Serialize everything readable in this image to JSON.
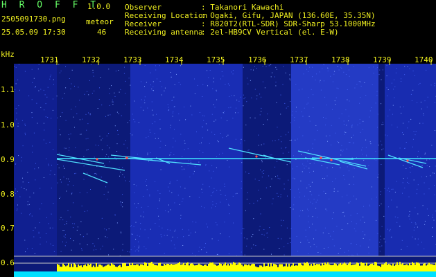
{
  "app": {
    "name": "H R O F F T",
    "version": "1.0.0",
    "filename": "2505091730.png",
    "datetime": "25.05.09 17:30",
    "count_label": "meteor",
    "count_value": "46"
  },
  "info": {
    "labels": [
      "Observer",
      "Receiving Location",
      "Receiver",
      "Receiving antenna"
    ],
    "values": [
      ": Takanori Kawachi",
      ": Ogaki, Gifu, JAPAN (136.60E, 35.35N)",
      ": R820T2(RTL-SDR) SDR-Sharp 53.1000MHz",
      ": 2el-HB9CV Vertical (el. E-W)"
    ]
  },
  "axis": {
    "y_unit": "kHz",
    "y_ticks": [
      "1.1",
      "1.0",
      "0.9",
      "0.8",
      "0.7",
      "0.6"
    ],
    "x_ticks": [
      "1731",
      "1732",
      "1733",
      "1734",
      "1735",
      "1736",
      "1737",
      "1738",
      "1739",
      "1740"
    ]
  },
  "colors": {
    "background": "#000000",
    "text": "#f0f020",
    "title_green": "#66ff66",
    "noise_blue": "#1a2cb0",
    "carrier": "#40e8ff",
    "level_yellow": "#ffff00",
    "level_cyan": "#00e0ff"
  },
  "chart_data": {
    "type": "heatmap",
    "x_range_minutes": [
      1731,
      1740
    ],
    "y_range_khz": [
      0.58,
      1.2
    ],
    "carrier_khz": 0.9,
    "meteor_count": 46
  }
}
